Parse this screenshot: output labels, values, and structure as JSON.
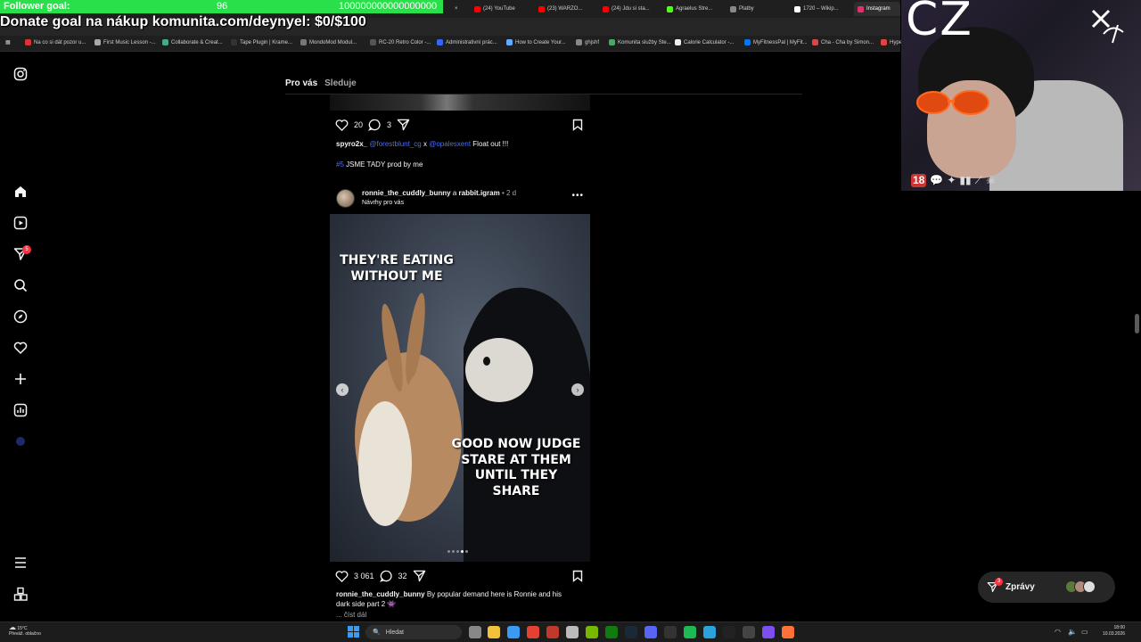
{
  "overlay": {
    "follower_goal_label": "Follower goal:",
    "follower_count": "96",
    "follower_target": "100000000000000000",
    "donate_text": "Donate goal na nákup komunita.com/deynyel: $0/$100",
    "webcam_badge_text": "CZ",
    "badge_18": "18"
  },
  "browser": {
    "tabs": [
      {
        "label": "(24) YouTube",
        "color": "#ff0000"
      },
      {
        "label": "(23) WARZO...",
        "color": "#ff0000"
      },
      {
        "label": "(24) Jdu si sta...",
        "color": "#ff0000"
      },
      {
        "label": "Agraelus Stre...",
        "color": "#53fc18"
      },
      {
        "label": "Platby",
        "color": "#888888"
      },
      {
        "label": "1720 – Wikip...",
        "color": "#ffffff"
      },
      {
        "label": "Instagram",
        "color": "#e1306c"
      }
    ],
    "bookmarks": [
      {
        "label": "Na co si dát pozor u...",
        "color": "#d33"
      },
      {
        "label": "First Music Lesson -...",
        "color": "#aaa"
      },
      {
        "label": "Collaborate & Creat...",
        "color": "#4a8"
      },
      {
        "label": "Tape Plugin | Krame...",
        "color": "#333"
      },
      {
        "label": "MondoMod Modul...",
        "color": "#777"
      },
      {
        "label": "RC-20 Retro Color -...",
        "color": "#555"
      },
      {
        "label": "Administrativní prác...",
        "color": "#36f"
      },
      {
        "label": "How to Create Your...",
        "color": "#6af"
      },
      {
        "label": "ghjshf",
        "color": "#888"
      },
      {
        "label": "Komunita služby Ste...",
        "color": "#4a6"
      },
      {
        "label": "Calorie Calculator -...",
        "color": "#eee"
      },
      {
        "label": "MyFitnessPal | MyFit...",
        "color": "#07f"
      },
      {
        "label": "Cha - Cha by Simon...",
        "color": "#d44"
      },
      {
        "label": "Hype",
        "color": "#d44"
      }
    ]
  },
  "feed": {
    "tab_for_you": "Pro vás",
    "tab_following": "Sleduje",
    "prev_post": {
      "likes": "20",
      "comments": "3",
      "caption_user": "spyro2x_",
      "caption_mention1": "@forestblunt_cg",
      "caption_x": "x",
      "caption_mention2": "@opalesxent",
      "caption_text": "Float out !!!",
      "tag": "#5",
      "line2": "JSME TADY prod by me"
    },
    "post": {
      "user": "ronnie_the_cuddly_bunny",
      "and_word": "a",
      "coauthor": "rabbit.igram",
      "time": "• 2 d",
      "suggested": "Návrhy pro vás",
      "more": "•••",
      "meme_top": "THEY'RE EATING\nWITHOUT ME",
      "meme_bottom": "GOOD NOW JUDGE\nSTARE AT THEM\nUNTIL THEY SHARE",
      "likes": "3 061",
      "comments": "32",
      "caption_user": "ronnie_the_cuddly_bunny",
      "caption_text": "By popular demand here is Ronnie and his",
      "caption_line2": "dark side part 2 👾",
      "read_more": "... číst dál"
    }
  },
  "sidebar": {
    "notif_count": "5"
  },
  "messages": {
    "label": "Zprávy",
    "badge": "3"
  },
  "taskbar": {
    "temp": "15°C",
    "weather": "Převáž. oblačno",
    "search": "Hledat",
    "time": "18:00",
    "date": "10.03.2026"
  },
  "colors": {
    "ig_blue": "#4c6ef5",
    "goal_green": "#29e04a",
    "notif_red": "#ff3040"
  }
}
